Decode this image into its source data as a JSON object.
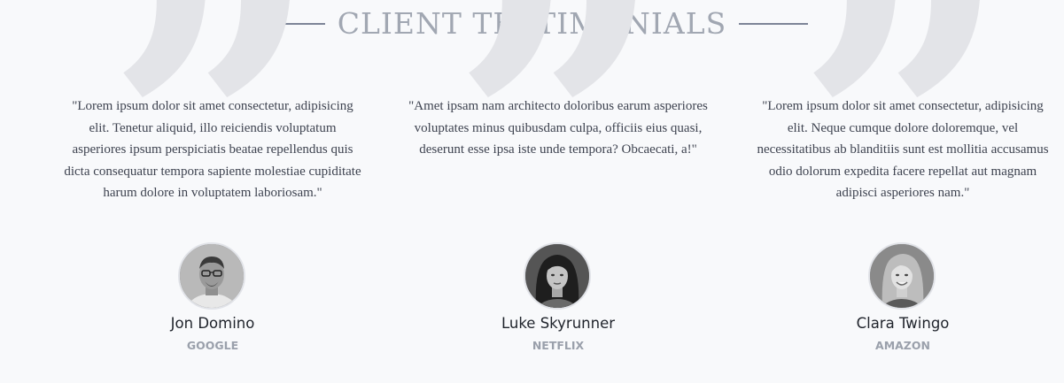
{
  "section": {
    "title": "CLIENT TESTIMONIALS"
  },
  "testimonials": [
    {
      "quote": "\"Lorem ipsum dolor sit amet consectetur, adipisicing elit. Tenetur aliquid, illo reiciendis voluptatum asperiores ipsum perspiciatis beatae repellendus quis dicta consequatur tempora sapiente molestiae cupiditate harum dolore in voluptatem laboriosam.\"",
      "name": "Jon Domino",
      "company": "GOOGLE",
      "avatar_icon": "avatar-man-glasses"
    },
    {
      "quote": "\"Amet ipsam nam architecto doloribus earum asperiores voluptates minus quibusdam culpa, officiis eius quasi, deserunt esse ipsa iste unde tempora? Obcaecati, a!\"",
      "name": "Luke Skyrunner",
      "company": "NETFLIX",
      "avatar_icon": "avatar-woman-dark-hair"
    },
    {
      "quote": "\"Lorem ipsum dolor sit amet consectetur, adipisicing elit. Neque cumque dolore doloremque, vel necessitatibus ab blanditiis sunt est mollitia accusamus odio dolorum expedita facere repellat aut magnam adipisci asperiores nam.\"",
      "name": "Clara Twingo",
      "company": "AMAZON",
      "avatar_icon": "avatar-woman-light-hair"
    }
  ],
  "colors": {
    "background": "#f8f9fb",
    "heading": "#a1a7b2",
    "quote_mark": "#e3e4e8",
    "name": "#1f232b",
    "company": "#9aa0ab"
  }
}
